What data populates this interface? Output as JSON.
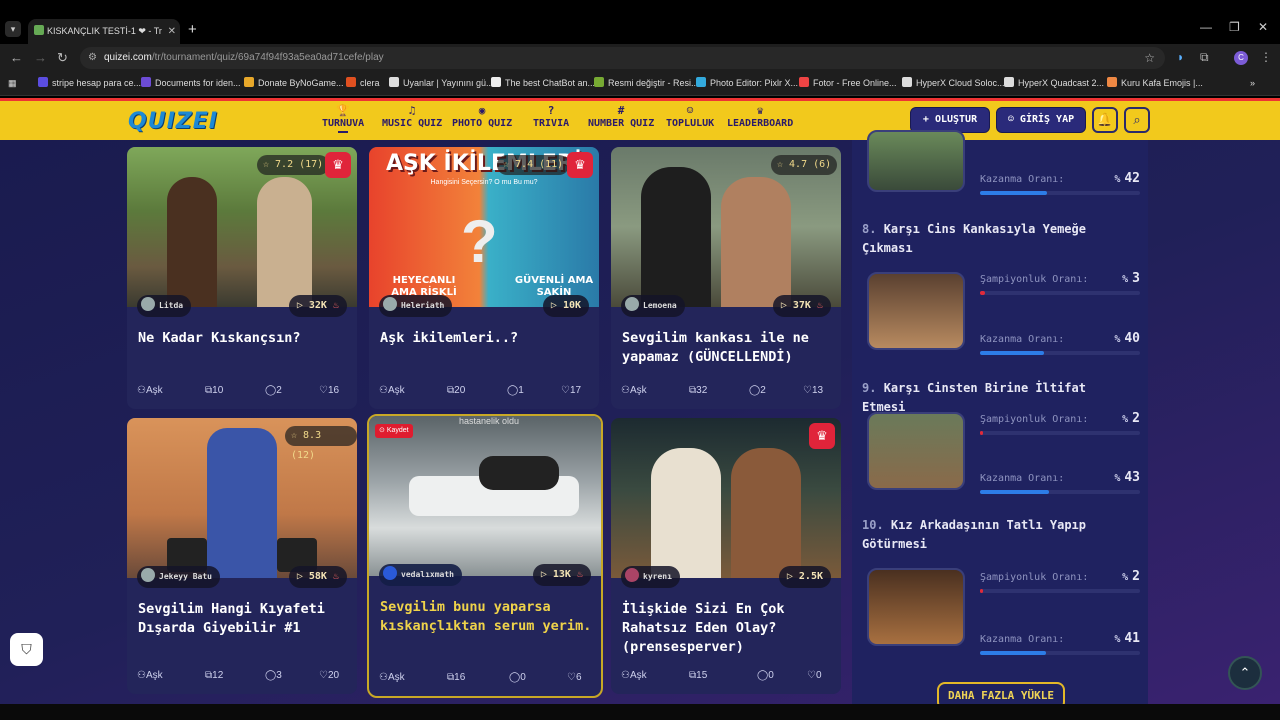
{
  "browser": {
    "tab_title": "KISKANÇLIK TESTİ-1 ❤ - Tr",
    "url_domain": "quizei.com",
    "url_path": "/tr/tournament/quiz/69a74f94f93a5ea0ad71cefe/play",
    "bookmarks": [
      "stripe hesap para ce...",
      "Documents for iden...",
      "Donate ByNoGame...",
      "clera",
      "Uyanlar | Yayınını gü...",
      "The best ChatBot an...",
      "Resmi değiştir - Resi...",
      "Photo Editor: Pixlr X...",
      "Fotor - Free Online...",
      "HyperX Cloud Soloc...",
      "HyperX Quadcast 2...",
      "Kuru Kafa Emojis |..."
    ]
  },
  "header": {
    "logo": "QUIZEI",
    "nav": [
      "TURNUVA",
      "MUSIC QUIZ",
      "PHOTO QUIZ",
      "TRIVIA",
      "NUMBER QUIZ",
      "TOPLULUK",
      "LEADERBOARD"
    ],
    "create": "+ OLUŞTUR",
    "login": "GİRİŞ YAP"
  },
  "cards": [
    {
      "rating": "☆ 7.2 (17)",
      "author": "Litda",
      "plays": "32K",
      "title": "Ne Kadar Kıskançsın?",
      "category": "Aşk",
      "questions": "10",
      "comments": "2",
      "likes": "16"
    },
    {
      "rating": "☆ 7.4 (11)",
      "author": "Heleriath",
      "plays": "10K",
      "title": "Aşk ikilemleri..?",
      "category": "Aşk",
      "questions": "20",
      "comments": "1",
      "likes": "17",
      "banner": "AŞK İKİLEMLERİ",
      "banner_sub": "Hangisini Seçersin? O mu Bu mu?",
      "left_label": "HEYECANLI AMA RİSKLİ",
      "right_label": "GÜVENLİ AMA SAKİN"
    },
    {
      "rating": "☆ 4.7 (6)",
      "author": "Lemoena",
      "plays": "37K",
      "title": "Sevgilim kankası ile ne yapamaz (GÜNCELLENDİ)",
      "category": "Aşk",
      "questions": "32",
      "comments": "2",
      "likes": "13"
    },
    {
      "rating": "☆ 8.3 (12)",
      "author": "Jekeyy Batu",
      "plays": "58K",
      "title": "Sevgilim Hangi Kıyafeti Dışarda Giyebilir #1",
      "category": "Aşk",
      "questions": "12",
      "comments": "3",
      "likes": "20"
    },
    {
      "saved": "Kaydet",
      "overlay": "hastanelik oldu",
      "author": "vedalıxmath",
      "plays": "13K",
      "title": "Sevgilim bunu yaparsa kıskançlıktan serum yerim.",
      "category": "Aşk",
      "questions": "16",
      "comments": "0",
      "likes": "6"
    },
    {
      "author": "kyrenı",
      "plays": "2.5K",
      "title": "İlişkide Sizi En Çok Rahatsız Eden Olay?(prensesperver)",
      "category": "Aşk",
      "questions": "15",
      "comments": "0",
      "likes": "0"
    }
  ],
  "sidebar": {
    "win_label": "Kazanma Oranı:",
    "champ_label": "Şampiyonluk Oranı:",
    "top": {
      "win": "42",
      "win_pct": 0.42
    },
    "items": [
      {
        "num": "8.",
        "title": "Karşı Cins Kankasıyla Yemeğe Çıkması",
        "champ": "3",
        "champ_pct": 0.03,
        "win": "40",
        "win_pct": 0.4
      },
      {
        "num": "9.",
        "title": "Karşı Cinsten Birine İltifat Etmesi",
        "champ": "2",
        "champ_pct": 0.02,
        "win": "43",
        "win_pct": 0.43
      },
      {
        "num": "10.",
        "title": "Kız Arkadaşının Tatlı Yapıp Götürmesi",
        "champ": "2",
        "champ_pct": 0.02,
        "win": "41",
        "win_pct": 0.41
      }
    ],
    "load_more": "DAHA FAZLA YÜKLE"
  }
}
